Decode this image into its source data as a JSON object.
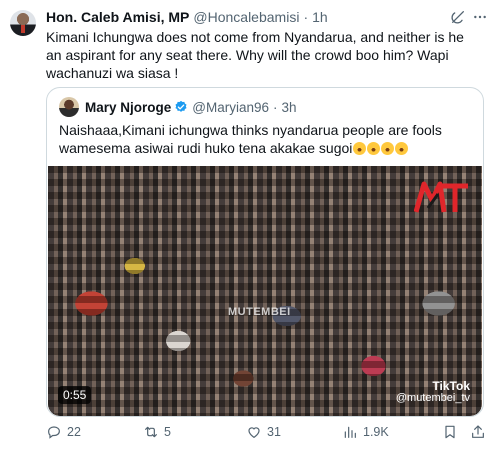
{
  "author": {
    "name": "Hon. Caleb Amisi, MP",
    "handle": "@Honcalebamisi",
    "separator": "·",
    "time": "1h"
  },
  "tweet_text": "Kimani Ichungwa does not come from Nyandarua, and neither is he an aspirant for any seat there. Why will the crowd boo him? Wapi wachanuzi wa siasa !",
  "quoted": {
    "name": "Mary Njoroge",
    "handle": "@Maryian96",
    "separator": "·",
    "time": "3h",
    "text": "Naishaaa,Kimani ichungwa thinks nyandarua people are fools wamesema asiwai rudi huko tena akakae sugoi",
    "video": {
      "duration": "0:55",
      "watermark": "MUTEMBEI",
      "tiktok_label": "TikTok",
      "tiktok_user": "@mutembei_tv"
    }
  },
  "actions": {
    "replies": "22",
    "reposts": "5",
    "likes": "31",
    "views": "1.9K"
  },
  "colors": {
    "muted": "#536471",
    "verified": "#1d9bf0",
    "border": "#cfd9de"
  }
}
